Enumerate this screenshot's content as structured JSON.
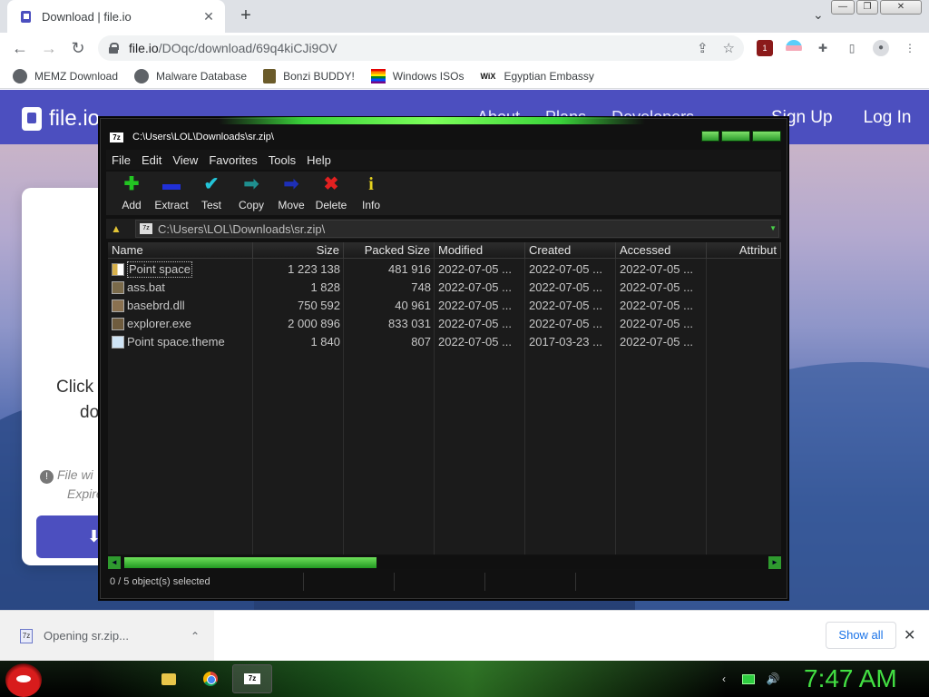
{
  "browser": {
    "tab_title": "Download | file.io",
    "tab_close": "✕",
    "new_tab": "+",
    "tab_search": "⌄",
    "window_controls": {
      "minimize": "—",
      "restore": "❐",
      "close": "✕"
    },
    "nav": {
      "back": "←",
      "forward": "→",
      "reload": "↻"
    },
    "url_host": "file.io",
    "url_path": "/DOqc/download/69q4kiCJi9OV",
    "omnibox_icons": {
      "share": "⇪",
      "star": "☆"
    },
    "extensions": {
      "badge": "1",
      "puzzle": "✚",
      "sidepanel": "▯",
      "profile": "●",
      "menu": "⋮"
    }
  },
  "bookmarks": [
    {
      "label": "MEMZ Download",
      "icon": "globe-icon"
    },
    {
      "label": "Malware Database",
      "icon": "globe-icon"
    },
    {
      "label": "Bonzi BUDDY!",
      "icon": "bonzi-icon"
    },
    {
      "label": "Windows ISOs",
      "icon": "rainbow-icon"
    },
    {
      "label": "Egyptian Embassy",
      "icon": "wix-icon",
      "icon_text": "WiX"
    }
  ],
  "site": {
    "logo": "file.io",
    "links": [
      "About",
      "Plans",
      "Developers"
    ],
    "sign_up": "Sign Up",
    "log_in": "Log In",
    "card_line1": "Click",
    "card_line2": "do",
    "note_line1": "File wi",
    "note_line2": "Expire",
    "note_alert": "!",
    "button_icon": "⬇"
  },
  "zip": {
    "title": "C:\\Users\\LOL\\Downloads\\sr.zip\\",
    "title_icon": "7z",
    "menu": [
      "File",
      "Edit",
      "View",
      "Favorites",
      "Tools",
      "Help"
    ],
    "tools": [
      {
        "label": "Add",
        "glyph": "✚",
        "color": "#22c522",
        "name": "add"
      },
      {
        "label": "Extract",
        "glyph": "▬",
        "color": "#2030d8",
        "name": "extract"
      },
      {
        "label": "Test",
        "glyph": "✔",
        "color": "#23c4d8",
        "name": "test"
      },
      {
        "label": "Copy",
        "glyph": "➡",
        "color": "#1f8f8f",
        "name": "copy"
      },
      {
        "label": "Move",
        "glyph": "➡",
        "color": "#1d2fb8",
        "name": "move"
      },
      {
        "label": "Delete",
        "glyph": "✖",
        "color": "#e32020",
        "name": "delete"
      },
      {
        "label": "Info",
        "glyph": "i",
        "color": "#e6d21e",
        "name": "info"
      }
    ],
    "address": "C:\\Users\\LOL\\Downloads\\sr.zip\\",
    "address_up": "▲",
    "address_drop": "▼",
    "columns": [
      "Name",
      "Size",
      "Packed Size",
      "Modified",
      "Created",
      "Accessed",
      "Attribut"
    ],
    "files": [
      {
        "name": "Point space",
        "size": "1 223 138",
        "packed": "481 916",
        "modified": "2022-07-05 ...",
        "created": "2022-07-05 ...",
        "accessed": "2022-07-05 ...",
        "icon": "dir"
      },
      {
        "name": "ass.bat",
        "size": "1 828",
        "packed": "748",
        "modified": "2022-07-05 ...",
        "created": "2022-07-05 ...",
        "accessed": "2022-07-05 ...",
        "icon": "bat"
      },
      {
        "name": "basebrd.dll",
        "size": "750 592",
        "packed": "40 961",
        "modified": "2022-07-05 ...",
        "created": "2022-07-05 ...",
        "accessed": "2022-07-05 ...",
        "icon": "dll"
      },
      {
        "name": "explorer.exe",
        "size": "2 000 896",
        "packed": "833 031",
        "modified": "2022-07-05 ...",
        "created": "2022-07-05 ...",
        "accessed": "2022-07-05 ...",
        "icon": "exe"
      },
      {
        "name": "Point space.theme",
        "size": "1 840",
        "packed": "807",
        "modified": "2022-07-05 ...",
        "created": "2017-03-23 ...",
        "accessed": "2022-07-05 ...",
        "icon": "theme"
      }
    ],
    "status": "0 / 5 object(s) selected",
    "scroll_left": "◄",
    "scroll_right": "►"
  },
  "download": {
    "label": "Opening sr.zip...",
    "icon_text": "7z",
    "chevron": "⌃",
    "show_all": "Show all",
    "close": "✕"
  },
  "taskbar": {
    "tray": {
      "chevron": "‹",
      "volume": "🔊"
    },
    "clock": "7:47 AM",
    "zip_label": "7z"
  }
}
